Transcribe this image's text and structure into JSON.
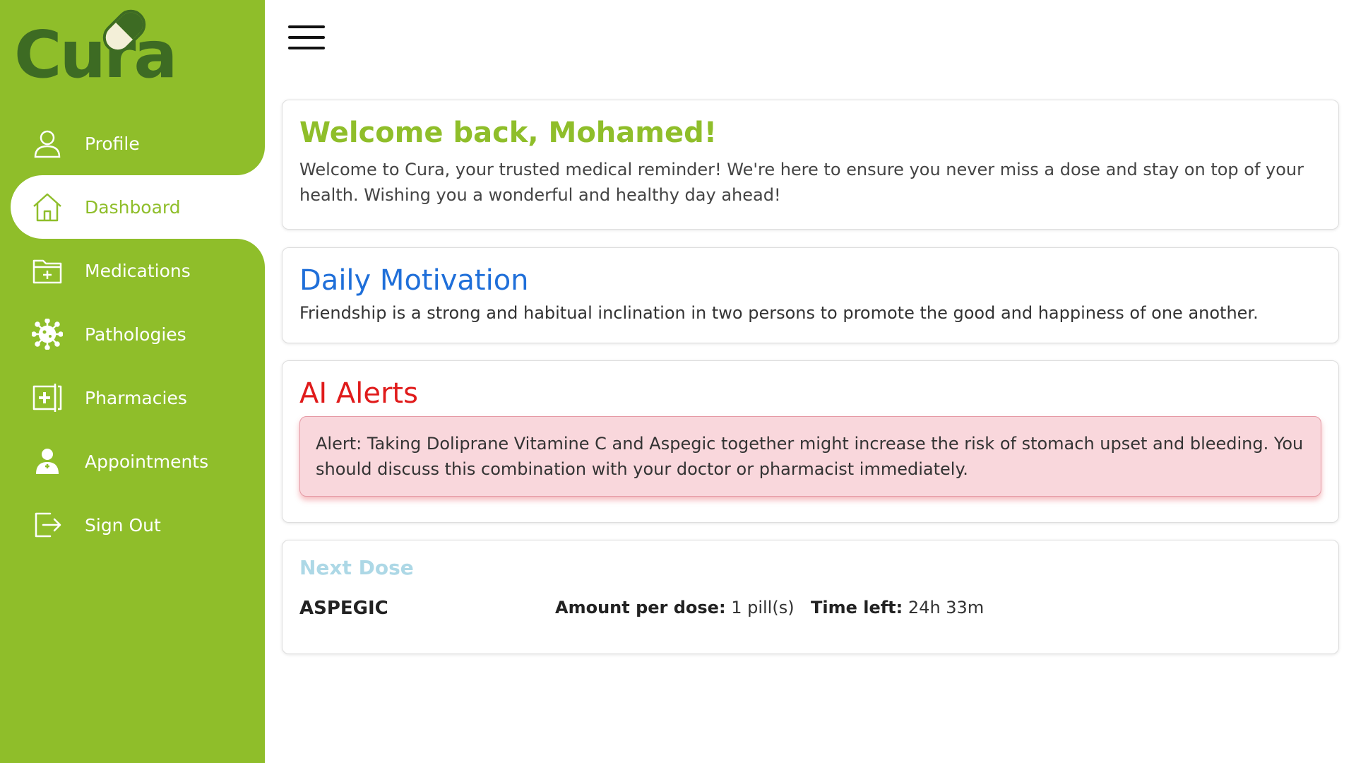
{
  "brand": {
    "logo_text": "Cura",
    "colors": {
      "sidebar": "#8fbe2a",
      "logo": "#3d6b23",
      "welcome": "#8fbe2a",
      "motivation": "#1f6fd9",
      "alert": "#e01b1b",
      "next_dose": "#add8e6"
    }
  },
  "sidebar": {
    "items": [
      {
        "label": "Profile",
        "icon": "user-icon"
      },
      {
        "label": "Dashboard",
        "icon": "home-icon",
        "active": true
      },
      {
        "label": "Medications",
        "icon": "folder-plus-icon"
      },
      {
        "label": "Pathologies",
        "icon": "virus-icon"
      },
      {
        "label": "Pharmacies",
        "icon": "pharmacy-icon"
      },
      {
        "label": "Appointments",
        "icon": "doctor-icon"
      },
      {
        "label": "Sign Out",
        "icon": "sign-out-icon"
      }
    ]
  },
  "header": {
    "menu_icon": "hamburger-icon"
  },
  "welcome": {
    "title": "Welcome back, Mohamed!",
    "text": "Welcome to Cura, your trusted medical reminder! We're here to ensure you never miss a dose and stay on top of your health. Wishing you a wonderful and healthy day ahead!"
  },
  "motivation": {
    "title": "Daily Motivation",
    "quote": "Friendship is a strong and habitual inclination in two persons to promote the good and happiness of one another."
  },
  "alerts": {
    "title": "AI Alerts",
    "message": "Alert: Taking Doliprane Vitamine C and Aspegic together might increase the risk of stomach upset and bleeding. You should discuss this combination with your doctor or pharmacist immediately."
  },
  "next_dose": {
    "title": "Next Dose",
    "medication": "ASPEGIC",
    "amount_label": "Amount per dose:",
    "amount_value": "1 pill(s)",
    "time_label": "Time left:",
    "time_value": "24h 33m"
  }
}
